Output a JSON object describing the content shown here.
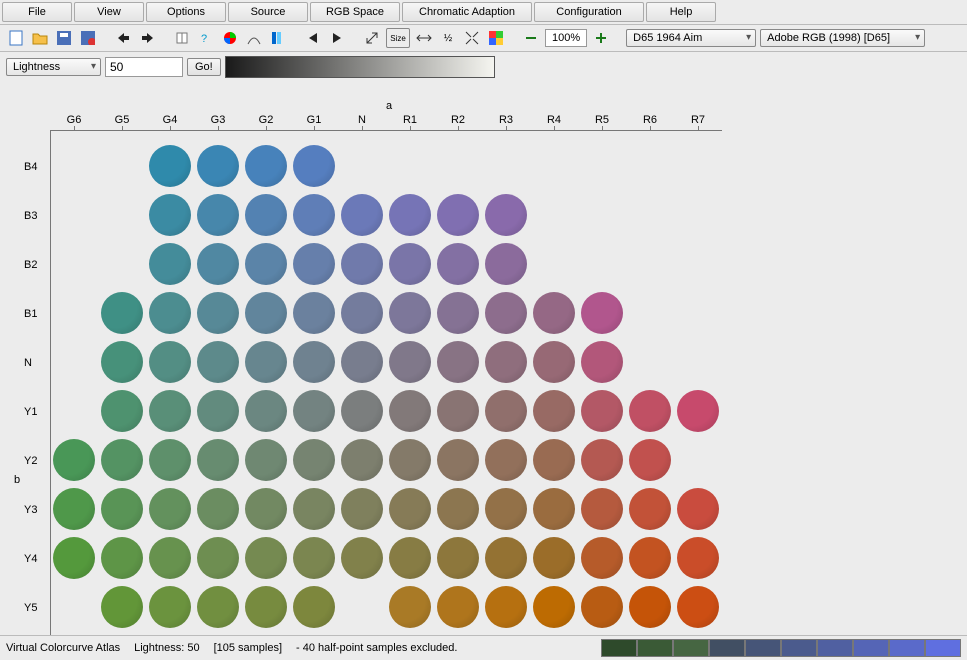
{
  "menu": [
    "File",
    "View",
    "Options",
    "Source",
    "RGB Space",
    "Chromatic Adaption",
    "Configuration",
    "Help"
  ],
  "toolbar": {
    "zoom": "100%",
    "illuminant": "D65 1964 Aim",
    "rgbspace": "Adobe RGB (1998) [D65]"
  },
  "control": {
    "axis_select": "Lightness",
    "axis_value": "50",
    "go_label": "Go!"
  },
  "chart_data": {
    "type": "scatter",
    "title": "",
    "xlabel": "a",
    "ylabel": "b",
    "x_categories": [
      "G6",
      "G5",
      "G4",
      "G3",
      "G2",
      "G1",
      "N",
      "R1",
      "R2",
      "R3",
      "R4",
      "R5",
      "R6",
      "R7"
    ],
    "y_categories": [
      "B4",
      "B3",
      "B2",
      "B1",
      "N",
      "Y1",
      "Y2",
      "Y3",
      "Y4",
      "Y5"
    ],
    "swatches": [
      {
        "y": "B4",
        "x": "G4",
        "color": "#2f8aab"
      },
      {
        "y": "B4",
        "x": "G3",
        "color": "#3a86b4"
      },
      {
        "y": "B4",
        "x": "G2",
        "color": "#4782bb"
      },
      {
        "y": "B4",
        "x": "G1",
        "color": "#557ebf"
      },
      {
        "y": "B3",
        "x": "G4",
        "color": "#3b8ba3"
      },
      {
        "y": "B3",
        "x": "G3",
        "color": "#4787ab"
      },
      {
        "y": "B3",
        "x": "G2",
        "color": "#5382b2"
      },
      {
        "y": "B3",
        "x": "G1",
        "color": "#5f7eb7"
      },
      {
        "y": "B3",
        "x": "N",
        "color": "#6b79b8"
      },
      {
        "y": "B3",
        "x": "R1",
        "color": "#7674b6"
      },
      {
        "y": "B3",
        "x": "R2",
        "color": "#806fb1"
      },
      {
        "y": "B3",
        "x": "R3",
        "color": "#896aab"
      },
      {
        "y": "B2",
        "x": "G4",
        "color": "#448c9a"
      },
      {
        "y": "B2",
        "x": "G3",
        "color": "#5088a2"
      },
      {
        "y": "B2",
        "x": "G2",
        "color": "#5b84a8"
      },
      {
        "y": "B2",
        "x": "G1",
        "color": "#667fab"
      },
      {
        "y": "B2",
        "x": "N",
        "color": "#707aab"
      },
      {
        "y": "B2",
        "x": "R1",
        "color": "#7a75a8"
      },
      {
        "y": "B2",
        "x": "R2",
        "color": "#8370a3"
      },
      {
        "y": "B2",
        "x": "R3",
        "color": "#8b6b9c"
      },
      {
        "y": "B1",
        "x": "G5",
        "color": "#3f9085"
      },
      {
        "y": "B1",
        "x": "G4",
        "color": "#4c8d90"
      },
      {
        "y": "B1",
        "x": "G3",
        "color": "#578997"
      },
      {
        "y": "B1",
        "x": "G2",
        "color": "#61859c"
      },
      {
        "y": "B1",
        "x": "G1",
        "color": "#6b819e"
      },
      {
        "y": "B1",
        "x": "N",
        "color": "#747c9d"
      },
      {
        "y": "B1",
        "x": "R1",
        "color": "#7d779a"
      },
      {
        "y": "B1",
        "x": "R2",
        "color": "#857294"
      },
      {
        "y": "B1",
        "x": "R3",
        "color": "#8d6d8d"
      },
      {
        "y": "B1",
        "x": "R4",
        "color": "#956885"
      },
      {
        "y": "B1",
        "x": "R5",
        "color": "#b1568d"
      },
      {
        "y": "N",
        "x": "G5",
        "color": "#47917a"
      },
      {
        "y": "N",
        "x": "G4",
        "color": "#538e84"
      },
      {
        "y": "N",
        "x": "G3",
        "color": "#5d8a8b"
      },
      {
        "y": "N",
        "x": "G2",
        "color": "#67868f"
      },
      {
        "y": "N",
        "x": "G1",
        "color": "#6f8290"
      },
      {
        "y": "N",
        "x": "N",
        "color": "#787d8e"
      },
      {
        "y": "N",
        "x": "R1",
        "color": "#80788a"
      },
      {
        "y": "N",
        "x": "R2",
        "color": "#887384"
      },
      {
        "y": "N",
        "x": "R3",
        "color": "#8f6e7d"
      },
      {
        "y": "N",
        "x": "R4",
        "color": "#976975"
      },
      {
        "y": "N",
        "x": "R5",
        "color": "#b2577a"
      },
      {
        "y": "Y1",
        "x": "G5",
        "color": "#4e926f"
      },
      {
        "y": "Y1",
        "x": "G4",
        "color": "#598f78"
      },
      {
        "y": "Y1",
        "x": "G3",
        "color": "#628b7e"
      },
      {
        "y": "Y1",
        "x": "G2",
        "color": "#6b8781"
      },
      {
        "y": "Y1",
        "x": "G1",
        "color": "#738381"
      },
      {
        "y": "Y1",
        "x": "N",
        "color": "#7b7e7e"
      },
      {
        "y": "Y1",
        "x": "R1",
        "color": "#827979"
      },
      {
        "y": "Y1",
        "x": "R2",
        "color": "#897473"
      },
      {
        "y": "Y1",
        "x": "R3",
        "color": "#906f6c"
      },
      {
        "y": "Y1",
        "x": "R4",
        "color": "#986a64"
      },
      {
        "y": "Y1",
        "x": "R5",
        "color": "#b35866"
      },
      {
        "y": "Y1",
        "x": "R6",
        "color": "#c05064"
      },
      {
        "y": "Y1",
        "x": "R7",
        "color": "#c74a6c"
      },
      {
        "y": "Y2",
        "x": "G6",
        "color": "#499757"
      },
      {
        "y": "Y2",
        "x": "G5",
        "color": "#549363"
      },
      {
        "y": "Y2",
        "x": "G4",
        "color": "#5e906b"
      },
      {
        "y": "Y2",
        "x": "G3",
        "color": "#678c70"
      },
      {
        "y": "Y2",
        "x": "G2",
        "color": "#6f8872"
      },
      {
        "y": "Y2",
        "x": "G1",
        "color": "#768471"
      },
      {
        "y": "Y2",
        "x": "N",
        "color": "#7d7f6e"
      },
      {
        "y": "Y2",
        "x": "R1",
        "color": "#847a69"
      },
      {
        "y": "Y2",
        "x": "R2",
        "color": "#8b7562"
      },
      {
        "y": "Y2",
        "x": "R3",
        "color": "#92705b"
      },
      {
        "y": "Y2",
        "x": "R4",
        "color": "#996b52"
      },
      {
        "y": "Y2",
        "x": "R5",
        "color": "#b45952"
      },
      {
        "y": "Y2",
        "x": "R6",
        "color": "#c1514e"
      },
      {
        "y": "Y3",
        "x": "G6",
        "color": "#4f984a"
      },
      {
        "y": "Y3",
        "x": "G5",
        "color": "#599456"
      },
      {
        "y": "Y3",
        "x": "G4",
        "color": "#63915d"
      },
      {
        "y": "Y3",
        "x": "G3",
        "color": "#6b8d61"
      },
      {
        "y": "Y3",
        "x": "G2",
        "color": "#728962"
      },
      {
        "y": "Y3",
        "x": "G1",
        "color": "#798561"
      },
      {
        "y": "Y3",
        "x": "N",
        "color": "#7f805d"
      },
      {
        "y": "Y3",
        "x": "R1",
        "color": "#867b57"
      },
      {
        "y": "Y3",
        "x": "R2",
        "color": "#8c7650"
      },
      {
        "y": "Y3",
        "x": "R3",
        "color": "#937148"
      },
      {
        "y": "Y3",
        "x": "R4",
        "color": "#9a6c3f"
      },
      {
        "y": "Y3",
        "x": "R5",
        "color": "#b55a3e"
      },
      {
        "y": "Y3",
        "x": "R6",
        "color": "#c25238"
      },
      {
        "y": "Y3",
        "x": "R7",
        "color": "#c94c3e"
      },
      {
        "y": "Y4",
        "x": "G6",
        "color": "#54993c"
      },
      {
        "y": "Y4",
        "x": "G5",
        "color": "#5e9547"
      },
      {
        "y": "Y4",
        "x": "G4",
        "color": "#67924e"
      },
      {
        "y": "Y4",
        "x": "G3",
        "color": "#6e8e51"
      },
      {
        "y": "Y4",
        "x": "G2",
        "color": "#758a51"
      },
      {
        "y": "Y4",
        "x": "G1",
        "color": "#7b8650"
      },
      {
        "y": "Y4",
        "x": "N",
        "color": "#81814b"
      },
      {
        "y": "Y4",
        "x": "R1",
        "color": "#877c44"
      },
      {
        "y": "Y4",
        "x": "R2",
        "color": "#8d773c"
      },
      {
        "y": "Y4",
        "x": "R3",
        "color": "#947233"
      },
      {
        "y": "Y4",
        "x": "R4",
        "color": "#9b6d29"
      },
      {
        "y": "Y4",
        "x": "R5",
        "color": "#b65b2a"
      },
      {
        "y": "Y4",
        "x": "R6",
        "color": "#c35321"
      },
      {
        "y": "Y4",
        "x": "R7",
        "color": "#ca4d29"
      },
      {
        "y": "Y5",
        "x": "G5",
        "color": "#629638"
      },
      {
        "y": "Y5",
        "x": "G4",
        "color": "#6b933e"
      },
      {
        "y": "Y5",
        "x": "G3",
        "color": "#718f40"
      },
      {
        "y": "Y5",
        "x": "G2",
        "color": "#778b3f"
      },
      {
        "y": "Y5",
        "x": "G1",
        "color": "#7d873d"
      },
      {
        "y": "Y5",
        "x": "R1",
        "color": "#a97a26"
      },
      {
        "y": "Y5",
        "x": "R2",
        "color": "#af751c"
      },
      {
        "y": "Y5",
        "x": "R3",
        "color": "#b67010"
      },
      {
        "y": "Y5",
        "x": "R4",
        "color": "#bd6b02"
      },
      {
        "y": "Y5",
        "x": "R5",
        "color": "#b85c13"
      },
      {
        "y": "Y5",
        "x": "R6",
        "color": "#c55408"
      },
      {
        "y": "Y5",
        "x": "R7",
        "color": "#cc4e13"
      }
    ]
  },
  "status": {
    "title": "Virtual Colorcurve Atlas",
    "lightness_label": "Lightness: 50",
    "samples": "[105 samples]",
    "excluded": "- 40 half-point samples excluded.",
    "strip_colors": [
      "#2e4a2b",
      "#3a5a36",
      "#466642",
      "#414f63",
      "#465578",
      "#4b5b8d",
      "#5060a1",
      "#5565b6",
      "#5a6aca",
      "#5f6fe0"
    ]
  }
}
